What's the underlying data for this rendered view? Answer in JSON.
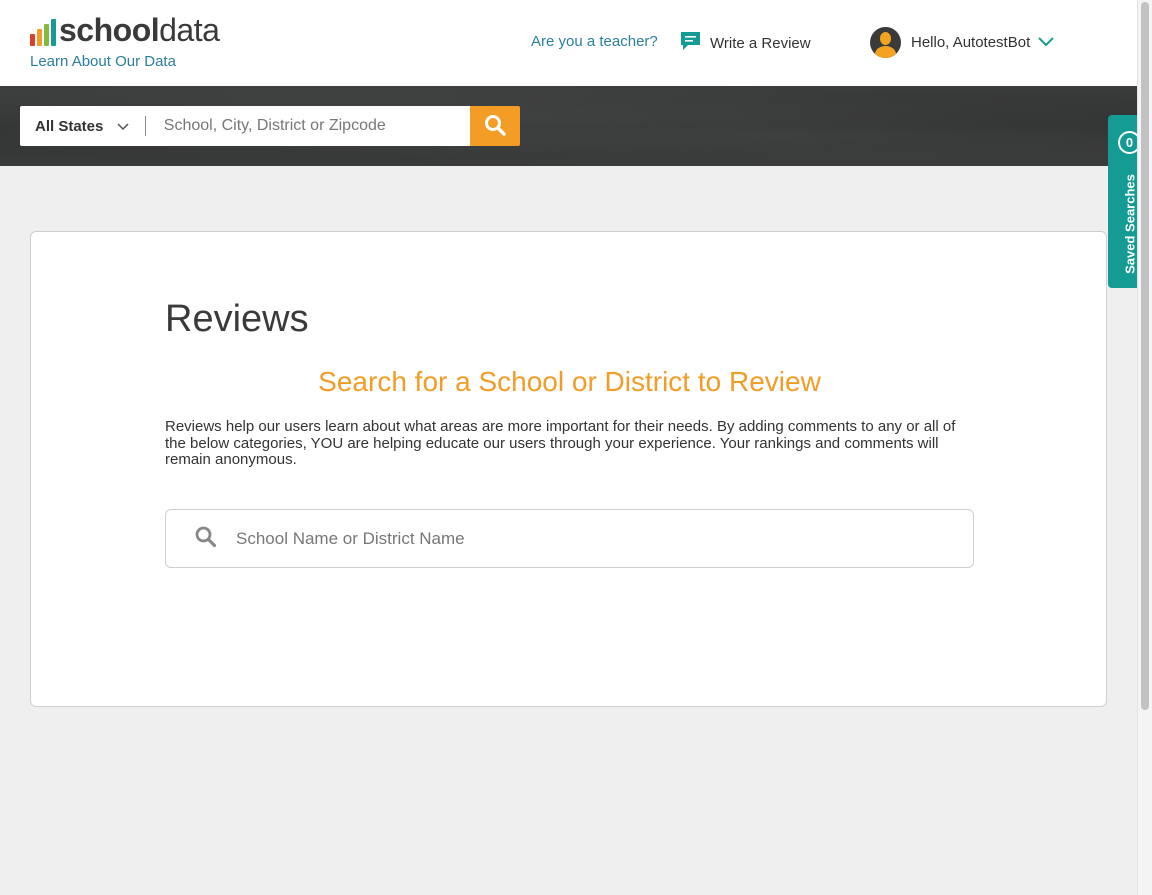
{
  "header": {
    "logo_brand_bold": "school",
    "logo_brand_light": "data",
    "logo_bar_colors": [
      "#d9412b",
      "#f39c26",
      "#8ab83c",
      "#139b94"
    ],
    "learn_link": "Learn About Our Data",
    "teacher_link": "Are you a teacher?",
    "write_review": "Write a Review",
    "user_greeting": "Hello, AutotestBot"
  },
  "searchbar": {
    "state_selected": "All States",
    "placeholder": "School, City, District or Zipcode",
    "button_icon": "search-icon"
  },
  "saved_searches": {
    "count": "0",
    "label": "Saved Searches"
  },
  "main": {
    "title": "Reviews",
    "subtitle": "Search for a School or District to Review",
    "intro": "Reviews help our users learn about what areas are more important for their needs. By adding comments to any or all of the below categories, YOU are helping educate our users through your experience. Your rankings and comments will remain anonymous.",
    "search_placeholder": "School Name or District Name"
  },
  "colors": {
    "accent_orange": "#f39c26",
    "accent_teal": "#139b94",
    "link_blue": "#2a7f9c"
  }
}
